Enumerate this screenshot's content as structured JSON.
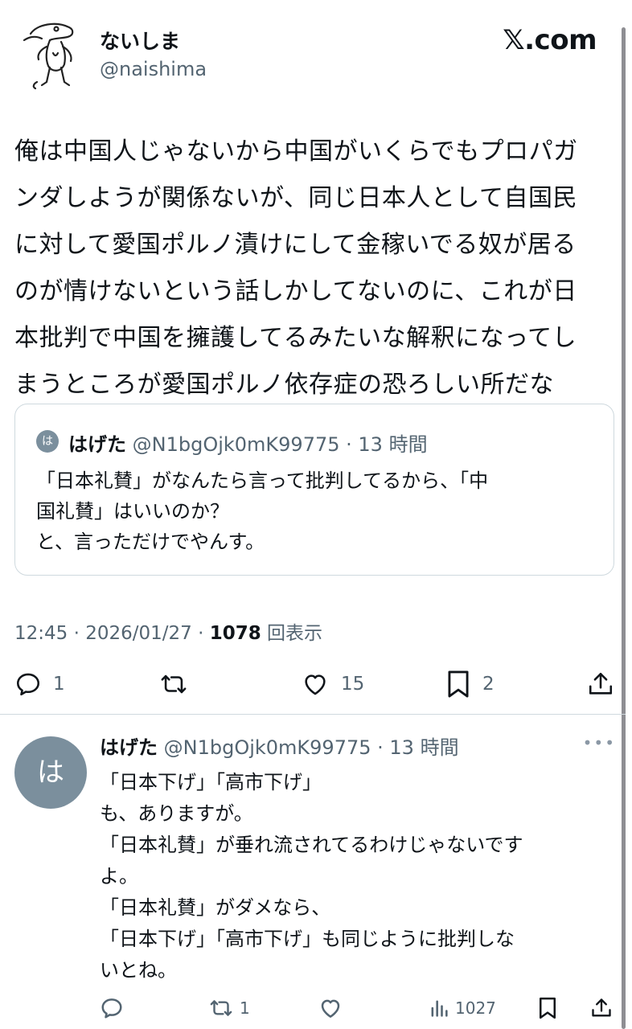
{
  "author": {
    "name": "ないしま",
    "handle": "@naishima"
  },
  "brand": "𝕏.com",
  "post_text": "俺は中国人じゃないから中国がいくらでもプロパガ\nンダしようが関係ないが、同じ日本人として自国民\nに対して愛国ポルノ漬けにして金稼いでる奴が居る\nのが情けないという話しかしてないのに、これが日\n本批判で中国を擁護してるみたいな解釈になってし\nまうところが愛国ポルノ依存症の恐ろしい所だな",
  "quote": {
    "avatar_letter": "は",
    "name": "はげた",
    "meta": " @N1bgOjk0mK99775 · 13 時間",
    "text": "「日本礼賛」がなんたら言って批判してるから、「中\n国礼賛」はいいのか？\nと、言っただけでやんす。"
  },
  "timestamp": {
    "time_date": "12:45 · 2026/01/27 · ",
    "views": "1078",
    "views_label": " 回表示"
  },
  "actions": {
    "replies": "1",
    "likes": "15",
    "bookmarks": "2"
  },
  "reply": {
    "avatar_letter": "は",
    "name": "はげた",
    "meta": " @N1bgOjk0mK99775 · 13 時間",
    "more": "•••",
    "text": "「日本下げ」「高市下げ」\nも、ありますが。\n「日本礼賛」が垂れ流されてるわけじゃないです\nよ。\n「日本礼賛」がダメなら、\n「日本下げ」「高市下げ」も同じように批判しな\nいとね。",
    "retweets": "1",
    "views": "1027"
  },
  "colors": {
    "text": "#0f1419",
    "secondary": "#536471",
    "avatar_bg": "#7b8f9d",
    "border": "#cfd9de"
  },
  "icons": [
    "reply-icon",
    "retweet-icon",
    "like-icon",
    "bookmark-icon",
    "share-icon",
    "views-icon",
    "more-icon"
  ]
}
